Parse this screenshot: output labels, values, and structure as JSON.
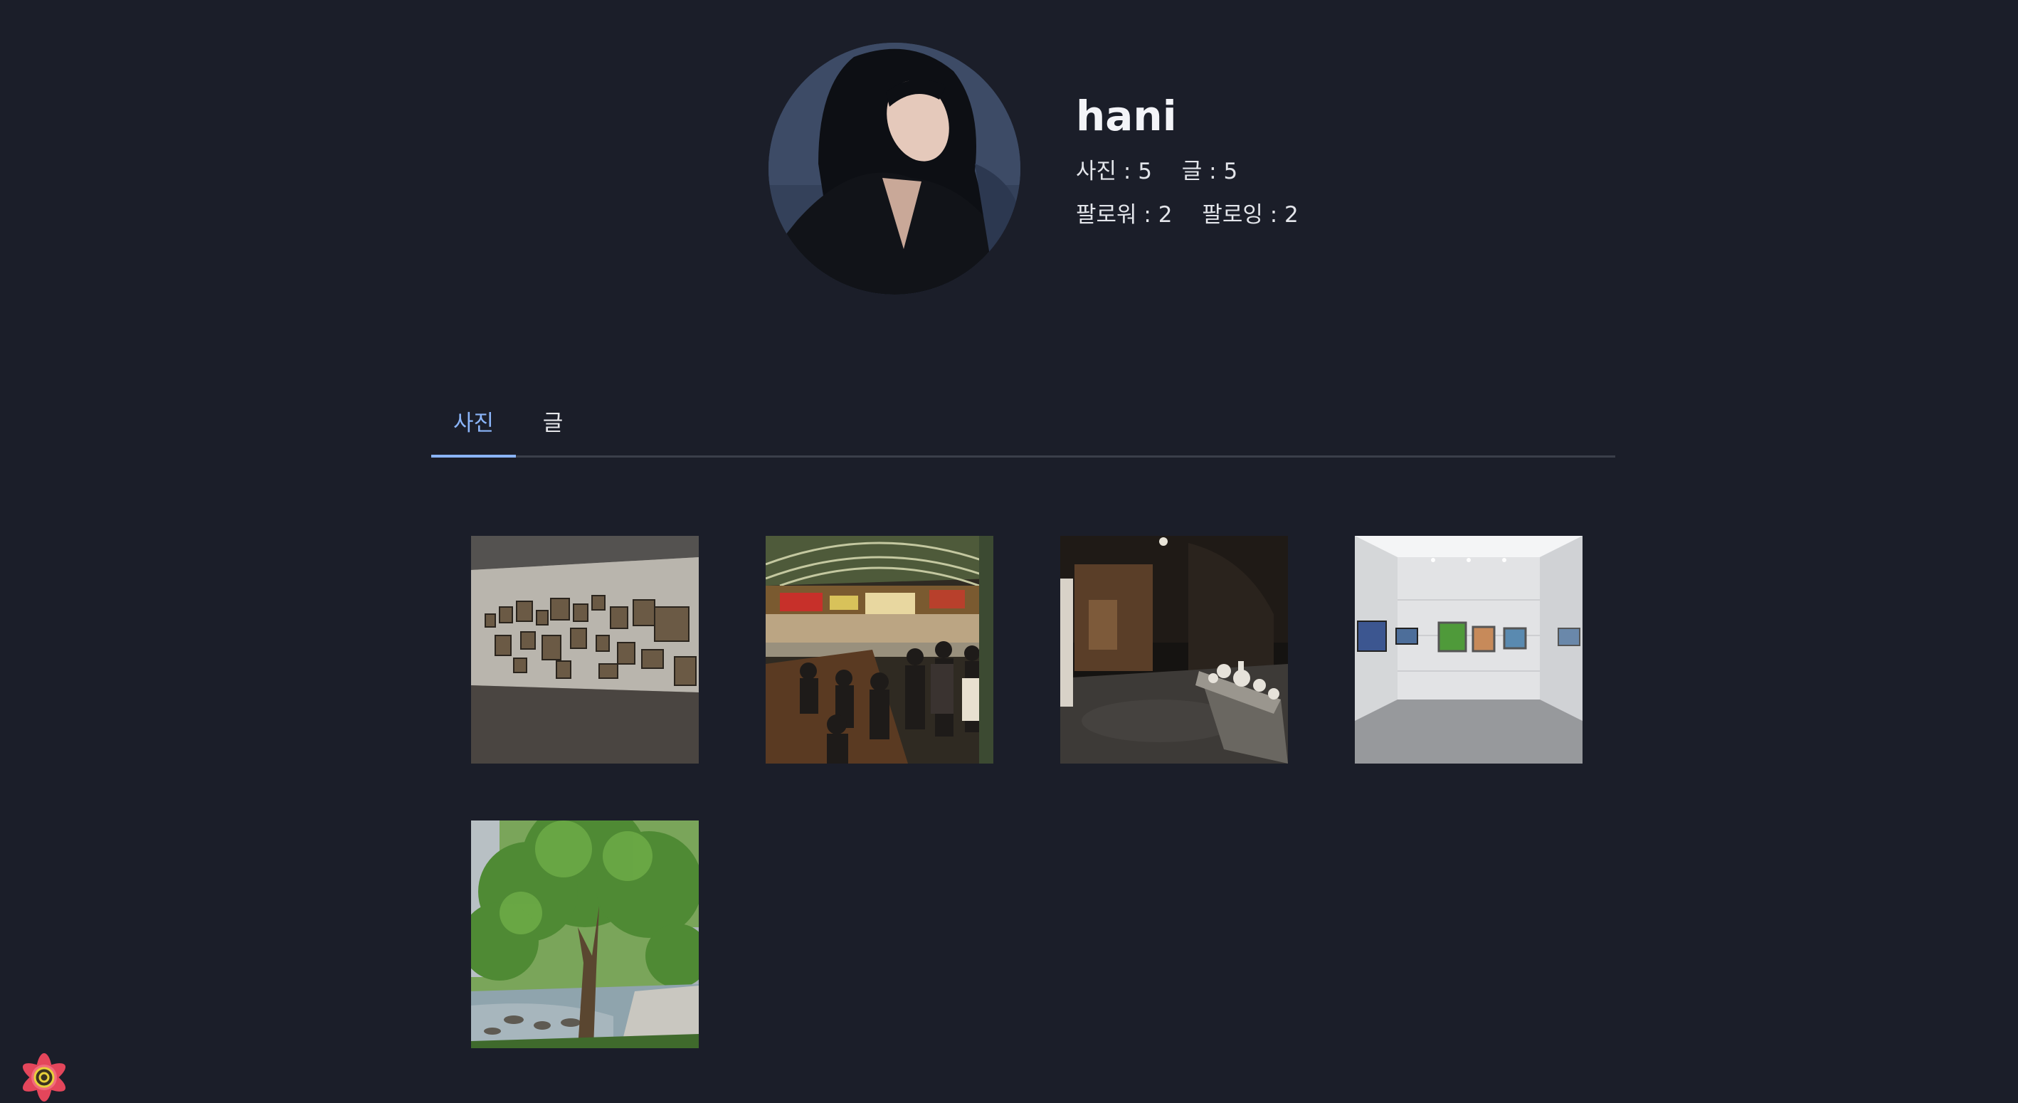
{
  "profile": {
    "username": "hani",
    "photo_count_label": "사진 : 5",
    "post_count_label": "글 : 5",
    "followers_label": "팔로워 : 2",
    "following_label": "팔로잉 : 2"
  },
  "tabs": [
    {
      "label": "사진",
      "active": true
    },
    {
      "label": "글",
      "active": false
    }
  ],
  "photos": [
    {
      "icon": "gallery-wall-frames-image"
    },
    {
      "icon": "night-market-crowd-image"
    },
    {
      "icon": "dark-museum-ceramics-image"
    },
    {
      "icon": "white-gallery-room-image"
    },
    {
      "icon": "tree-by-stream-image"
    }
  ],
  "colors": {
    "background": "#1b1e29",
    "accent": "#8ab4f8",
    "tab_divider": "#3b3f4a"
  },
  "devtools_badge": {
    "icon": "react-query-devtools-icon"
  }
}
